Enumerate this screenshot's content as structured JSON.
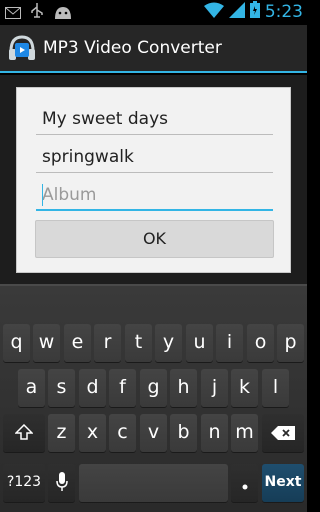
{
  "status_bar": {
    "time": "5:23"
  },
  "app": {
    "title": "MP3 Video Converter"
  },
  "dialog": {
    "fields": [
      {
        "value": "My sweet days",
        "placeholder": ""
      },
      {
        "value": "springwalk",
        "placeholder": ""
      },
      {
        "value": "",
        "placeholder": "Album"
      }
    ],
    "ok_label": "OK"
  },
  "keyboard": {
    "row1": [
      "q",
      "w",
      "e",
      "r",
      "t",
      "y",
      "u",
      "i",
      "o",
      "p"
    ],
    "row2": [
      "a",
      "s",
      "d",
      "f",
      "g",
      "h",
      "j",
      "k",
      "l"
    ],
    "row3": [
      "z",
      "x",
      "c",
      "v",
      "b",
      "n",
      "m"
    ],
    "symbols_label": "?123",
    "next_label": "Next"
  },
  "colors": {
    "accent": "#33b5e5",
    "action_bar": "#262626",
    "dialog_bg": "#f2f2f2"
  }
}
